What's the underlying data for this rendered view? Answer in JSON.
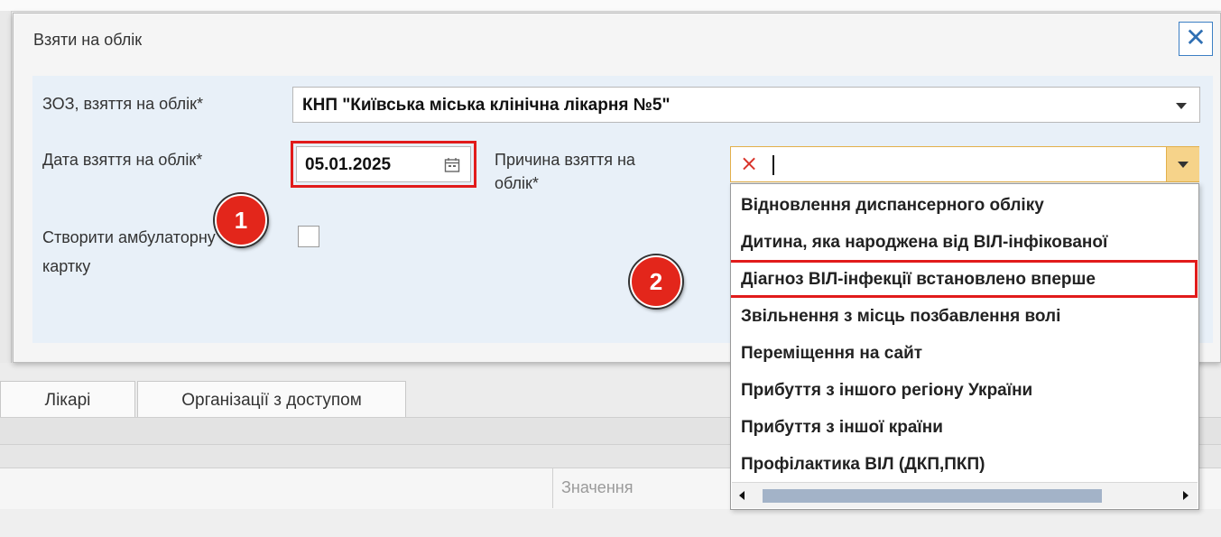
{
  "dialog": {
    "title": "Взяти на облік",
    "close_icon": "close-icon"
  },
  "form": {
    "zoz_label": "ЗОЗ, взяття на облік*",
    "zoz_value": "КНП \"Київська міська клінічна лікарня №5\"",
    "date_label": "Дата взяття на облік*",
    "date_value": "05.01.2025",
    "reason_label_line1": "Причина взяття на",
    "reason_label_line2": "облік*",
    "reason_value": "",
    "ambulatory_label_line1": "Створити амбулаторну",
    "ambulatory_label_line2": "картку",
    "ambulatory_checked": false
  },
  "dropdown": {
    "items": [
      "Відновлення диспансерного обліку",
      "Дитина, яка народжена від ВІЛ-інфікованої",
      "Діагноз ВІЛ-інфекції встановлено вперше",
      "Звільнення з місць позбавлення волі",
      "Переміщення на сайт",
      "Прибуття з іншого регіону України",
      "Прибуття з іншої країни",
      "Профілактика ВІЛ (ДКП,ПКП)"
    ],
    "highlighted_index": 2
  },
  "markers": [
    "1",
    "2"
  ],
  "background": {
    "tabs": [
      "Лікарі",
      "Організації з доступом"
    ],
    "column_header": "Значення"
  },
  "colors": {
    "highlight": "#e11b1b",
    "marker": "#e3261b",
    "accent": "#2f6fb3"
  }
}
